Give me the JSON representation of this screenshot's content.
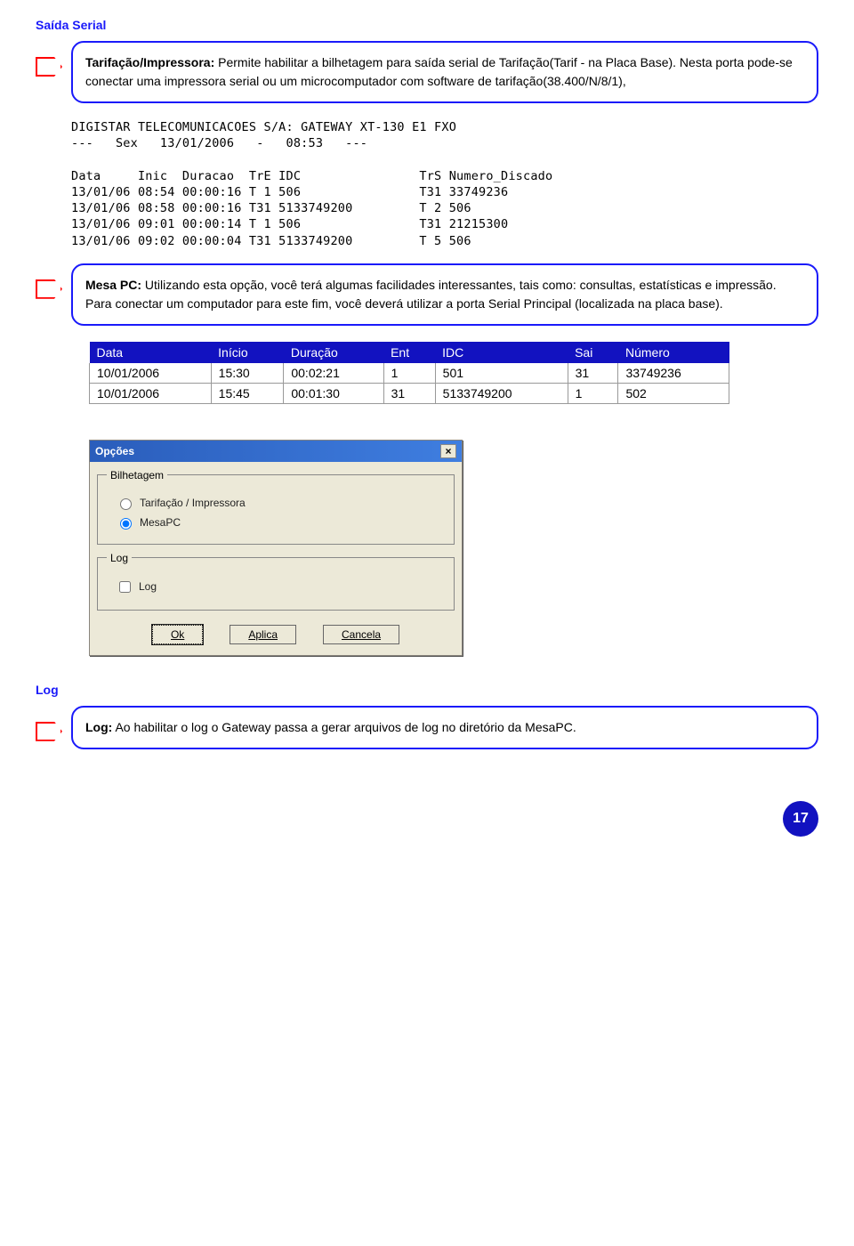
{
  "page_number": "17",
  "section1": {
    "title": "Saída Serial",
    "callout_label": "Tarifação/Impressora:",
    "callout_text": " Permite habilitar a bilhetagem para saída serial de Tarifação(Tarif - na Placa Base). Nesta porta pode-se conectar uma impressora serial ou um microcomputador com software de tarifação(38.400/N/8/1),"
  },
  "terminal_block": "DIGISTAR TELECOMUNICACOES S/A: GATEWAY XT-130 E1 FXO\n---   Sex   13/01/2006   -   08:53   ---\n\nData     Inic  Duracao  TrE IDC                TrS Numero_Discado\n13/01/06 08:54 00:00:16 T 1 506                T31 33749236\n13/01/06 08:58 00:00:16 T31 5133749200         T 2 506\n13/01/06 09:01 00:00:14 T 1 506                T31 21215300\n13/01/06 09:02 00:00:04 T31 5133749200         T 5 506",
  "section2": {
    "callout_label": "Mesa PC:",
    "callout_text": " Utilizando esta opção, você terá algumas facilidades interessantes, tais como: consultas, estatísticas e impressão. Para conectar um computador para este fim, você deverá utilizar a porta Serial Principal (localizada na placa base)."
  },
  "table": {
    "headers": [
      "Data",
      "Início",
      "Duração",
      "Ent",
      "IDC",
      "Sai",
      "Número"
    ],
    "rows": [
      [
        "10/01/2006",
        "15:30",
        "00:02:21",
        "1",
        "501",
        "31",
        "33749236"
      ],
      [
        "10/01/2006",
        "15:45",
        "00:01:30",
        "31",
        "5133749200",
        "1",
        "502"
      ]
    ]
  },
  "window": {
    "title": "Opções",
    "group1_legend": "Bilhetagem",
    "radio1": "Tarifação / Impressora",
    "radio2": "MesaPC",
    "group2_legend": "Log",
    "check1": "Log",
    "btn_ok": "Ok",
    "btn_apply": "Aplica",
    "btn_cancel": "Cancela"
  },
  "section3": {
    "title": "Log",
    "callout_label": "Log:",
    "callout_text": " Ao habilitar o log o Gateway passa a gerar arquivos de log no diretório da MesaPC."
  }
}
